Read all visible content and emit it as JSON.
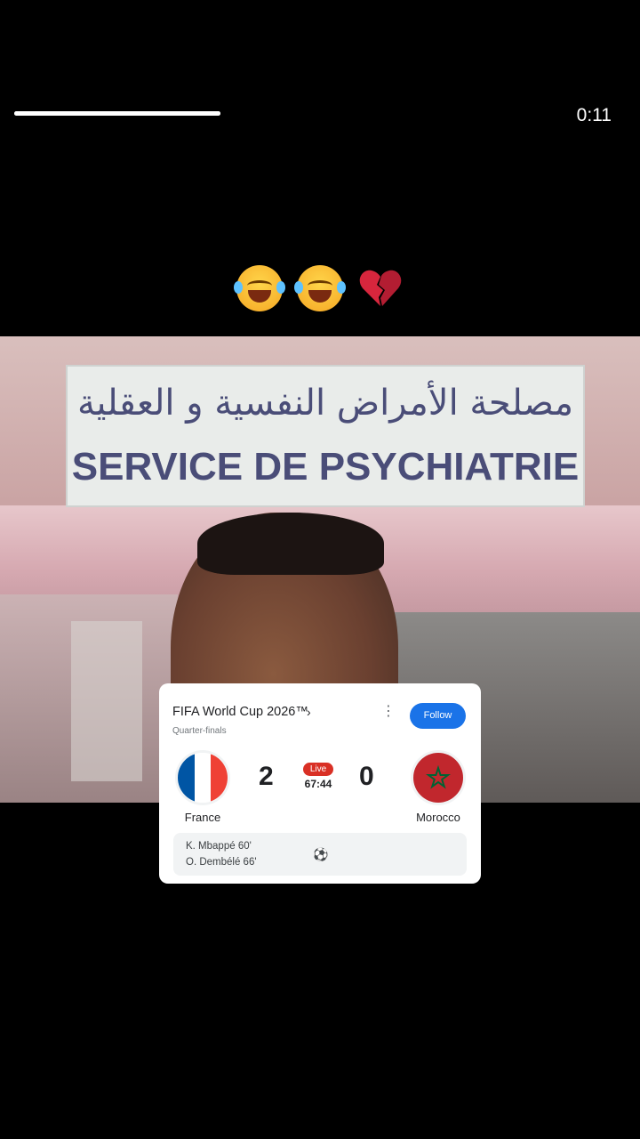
{
  "status": {
    "username_progress_text": "",
    "progress_fraction": 1.0,
    "time": "0:11"
  },
  "caption": {
    "emojis": [
      "laughing-crying-face",
      "laughing-crying-face",
      "broken-heart"
    ]
  },
  "photo": {
    "sign_arabic": "مصلحة الأمراض النفسية و العقلية",
    "sign_latin": "SERVICE DE PSYCHIATRIE"
  },
  "score_card": {
    "title": "FIFA World Cup 2026™",
    "chevron": "›",
    "subtitle": "Quarter-finals",
    "more_icon": "⋮",
    "follow_label": "Follow",
    "live_label": "Live",
    "match_clock": "67:44",
    "home": {
      "name": "France",
      "score": "2",
      "flag_colors": [
        "#0055a4",
        "#ffffff",
        "#ef4135"
      ]
    },
    "away": {
      "name": "Morocco",
      "score": "0",
      "flag_colors": [
        "#c1272d",
        "#006233"
      ]
    },
    "events": [
      {
        "text": "K. Mbappé 60'"
      },
      {
        "text": "O. Dembélé 66'"
      }
    ],
    "event_icon": "⚽",
    "colors": {
      "accent": "#1a73e8",
      "live": "#d93025"
    }
  }
}
